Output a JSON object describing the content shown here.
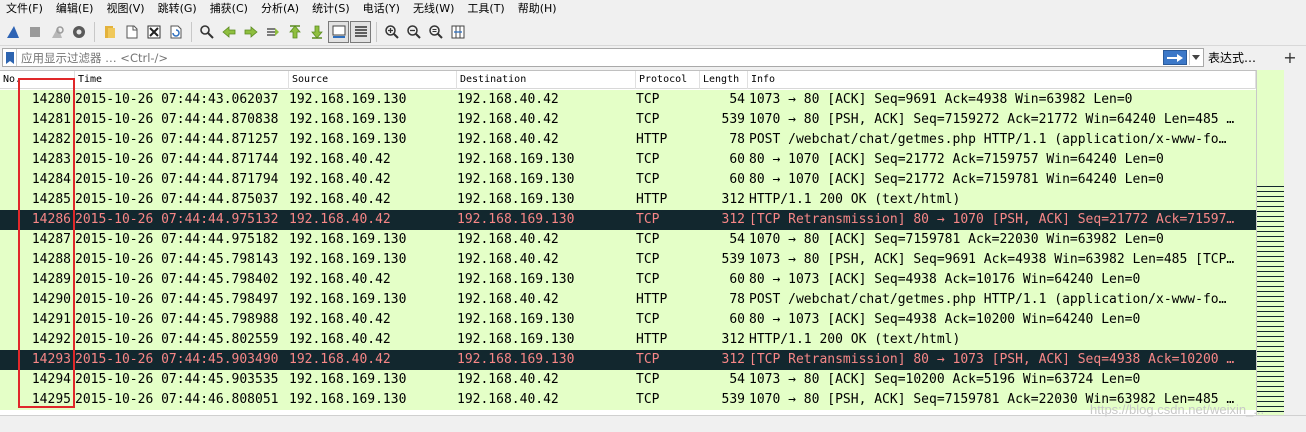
{
  "menubar": {
    "items": [
      {
        "label": "文件(F)"
      },
      {
        "label": "编辑(E)"
      },
      {
        "label": "视图(V)"
      },
      {
        "label": "跳转(G)"
      },
      {
        "label": "捕获(C)"
      },
      {
        "label": "分析(A)"
      },
      {
        "label": "统计(S)"
      },
      {
        "label": "电话(Y)"
      },
      {
        "label": "无线(W)"
      },
      {
        "label": "工具(T)"
      },
      {
        "label": "帮助(H)"
      }
    ]
  },
  "toolbar": {
    "buttons": [
      {
        "icon": "shark-fin-start-icon"
      },
      {
        "icon": "stop-capture-icon"
      },
      {
        "icon": "restart-capture-icon"
      },
      {
        "icon": "capture-options-icon"
      },
      {
        "icon": "open-file-icon"
      },
      {
        "icon": "save-file-icon"
      },
      {
        "icon": "close-file-icon"
      },
      {
        "icon": "reload-file-icon"
      },
      {
        "icon": "find-packet-icon"
      },
      {
        "icon": "go-back-icon"
      },
      {
        "icon": "go-forward-icon"
      },
      {
        "icon": "go-to-packet-icon"
      },
      {
        "icon": "go-first-icon"
      },
      {
        "icon": "go-last-icon"
      },
      {
        "icon": "auto-scroll-icon"
      },
      {
        "icon": "colorize-icon"
      },
      {
        "icon": "zoom-in-icon"
      },
      {
        "icon": "zoom-out-icon"
      },
      {
        "icon": "zoom-normal-icon"
      },
      {
        "icon": "resize-columns-icon"
      }
    ]
  },
  "filter": {
    "placeholder": "应用显示过滤器 … <Ctrl-/>",
    "expression_label": "表达式…",
    "add_label": "+"
  },
  "packet_list": {
    "columns": [
      "No.",
      "Time",
      "Source",
      "Destination",
      "Protocol",
      "Length",
      "Info"
    ],
    "rows": [
      {
        "no": "14280",
        "time": "2015-10-26 07:44:43.062037",
        "src": "192.168.169.130",
        "dst": "192.168.40.42",
        "proto": "TCP",
        "len": "54",
        "info": "1073 → 80 [ACK] Seq=9691 Ack=4938 Win=63982 Len=0",
        "selected": false
      },
      {
        "no": "14281",
        "time": "2015-10-26 07:44:44.870838",
        "src": "192.168.169.130",
        "dst": "192.168.40.42",
        "proto": "TCP",
        "len": "539",
        "info": "1070 → 80 [PSH, ACK] Seq=7159272 Ack=21772 Win=64240 Len=485 …",
        "selected": false
      },
      {
        "no": "14282",
        "time": "2015-10-26 07:44:44.871257",
        "src": "192.168.169.130",
        "dst": "192.168.40.42",
        "proto": "HTTP",
        "len": "78",
        "info": "POST /webchat/chat/getmes.php HTTP/1.1  (application/x-www-fo…",
        "selected": false
      },
      {
        "no": "14283",
        "time": "2015-10-26 07:44:44.871744",
        "src": "192.168.40.42",
        "dst": "192.168.169.130",
        "proto": "TCP",
        "len": "60",
        "info": "80 → 1070 [ACK] Seq=21772 Ack=7159757 Win=64240 Len=0",
        "selected": false
      },
      {
        "no": "14284",
        "time": "2015-10-26 07:44:44.871794",
        "src": "192.168.40.42",
        "dst": "192.168.169.130",
        "proto": "TCP",
        "len": "60",
        "info": "80 → 1070 [ACK] Seq=21772 Ack=7159781 Win=64240 Len=0",
        "selected": false
      },
      {
        "no": "14285",
        "time": "2015-10-26 07:44:44.875037",
        "src": "192.168.40.42",
        "dst": "192.168.169.130",
        "proto": "HTTP",
        "len": "312",
        "info": "HTTP/1.1 200 OK  (text/html)",
        "selected": false
      },
      {
        "no": "14286",
        "time": "2015-10-26 07:44:44.975132",
        "src": "192.168.40.42",
        "dst": "192.168.169.130",
        "proto": "TCP",
        "len": "312",
        "info": "[TCP Retransmission] 80 → 1070 [PSH, ACK] Seq=21772 Ack=71597…",
        "selected": true
      },
      {
        "no": "14287",
        "time": "2015-10-26 07:44:44.975182",
        "src": "192.168.169.130",
        "dst": "192.168.40.42",
        "proto": "TCP",
        "len": "54",
        "info": "1070 → 80 [ACK] Seq=7159781 Ack=22030 Win=63982 Len=0",
        "selected": false
      },
      {
        "no": "14288",
        "time": "2015-10-26 07:44:45.798143",
        "src": "192.168.169.130",
        "dst": "192.168.40.42",
        "proto": "TCP",
        "len": "539",
        "info": "1073 → 80 [PSH, ACK] Seq=9691 Ack=4938 Win=63982 Len=485 [TCP…",
        "selected": false
      },
      {
        "no": "14289",
        "time": "2015-10-26 07:44:45.798402",
        "src": "192.168.40.42",
        "dst": "192.168.169.130",
        "proto": "TCP",
        "len": "60",
        "info": "80 → 1073 [ACK] Seq=4938 Ack=10176 Win=64240 Len=0",
        "selected": false
      },
      {
        "no": "14290",
        "time": "2015-10-26 07:44:45.798497",
        "src": "192.168.169.130",
        "dst": "192.168.40.42",
        "proto": "HTTP",
        "len": "78",
        "info": "POST /webchat/chat/getmes.php HTTP/1.1  (application/x-www-fo…",
        "selected": false
      },
      {
        "no": "14291",
        "time": "2015-10-26 07:44:45.798988",
        "src": "192.168.40.42",
        "dst": "192.168.169.130",
        "proto": "TCP",
        "len": "60",
        "info": "80 → 1073 [ACK] Seq=4938 Ack=10200 Win=64240 Len=0",
        "selected": false
      },
      {
        "no": "14292",
        "time": "2015-10-26 07:44:45.802559",
        "src": "192.168.40.42",
        "dst": "192.168.169.130",
        "proto": "HTTP",
        "len": "312",
        "info": "HTTP/1.1 200 OK  (text/html)",
        "selected": false
      },
      {
        "no": "14293",
        "time": "2015-10-26 07:44:45.903490",
        "src": "192.168.40.42",
        "dst": "192.168.169.130",
        "proto": "TCP",
        "len": "312",
        "info": "[TCP Retransmission] 80 → 1073 [PSH, ACK] Seq=4938 Ack=10200 …",
        "selected": true
      },
      {
        "no": "14294",
        "time": "2015-10-26 07:44:45.903535",
        "src": "192.168.169.130",
        "dst": "192.168.40.42",
        "proto": "TCP",
        "len": "54",
        "info": "1073 → 80 [ACK] Seq=10200 Ack=5196 Win=63724 Len=0",
        "selected": false
      },
      {
        "no": "14295",
        "time": "2015-10-26 07:44:46.808051",
        "src": "192.168.169.130",
        "dst": "192.168.40.42",
        "proto": "TCP",
        "len": "539",
        "info": "1070 → 80 [PSH, ACK] Seq=7159781 Ack=22030 Win=63982 Len=485 …",
        "selected": false
      }
    ]
  },
  "colors": {
    "row_bg": "#e4ffc7",
    "selected_bg": "#12272e",
    "selected_fg": "#f78787",
    "highlight_box": "#e0282a"
  },
  "watermark": "https://blog.csdn.net/weixin_..."
}
